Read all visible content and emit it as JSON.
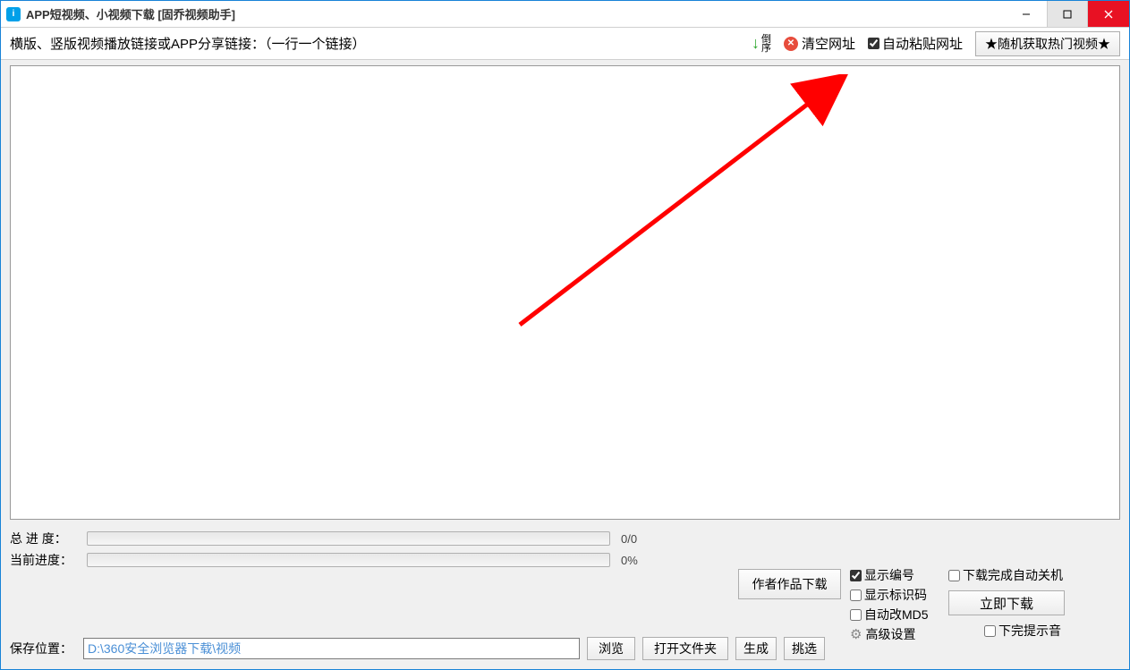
{
  "title": "APP短视频、小视频下载 [固乔视频助手]",
  "toolbar": {
    "prompt": "横版、竖版视频播放链接或APP分享链接：（一行一个链接）",
    "sort_label_1": "倒",
    "sort_label_2": "序",
    "clear_label": "清空网址",
    "autopaste_label": "自动粘贴网址",
    "autopaste_checked": true,
    "hot_button": "★随机获取热门视频★"
  },
  "url_textarea_value": "",
  "progress": {
    "total_label": "总 进 度：",
    "total_value": "0/0",
    "current_label": "当前进度：",
    "current_value": "0%"
  },
  "save": {
    "label": "保存位置：",
    "path": "D:\\360安全浏览器下载\\视频",
    "browse_btn": "浏览",
    "open_folder_btn": "打开文件夹",
    "gen_btn": "生成",
    "pick_btn": "挑选"
  },
  "right": {
    "author_works_btn": "作者作品下载",
    "show_number": {
      "label": "显示编号",
      "checked": true
    },
    "show_code": {
      "label": "显示标识码",
      "checked": false
    },
    "auto_md5": {
      "label": "自动改MD5",
      "checked": false
    },
    "adv_settings": "高级设置",
    "auto_shutdown": {
      "label": "下载完成自动关机",
      "checked": false
    },
    "download_now_btn": "立即下载",
    "done_sound": {
      "label": "下完提示音",
      "checked": false
    }
  }
}
